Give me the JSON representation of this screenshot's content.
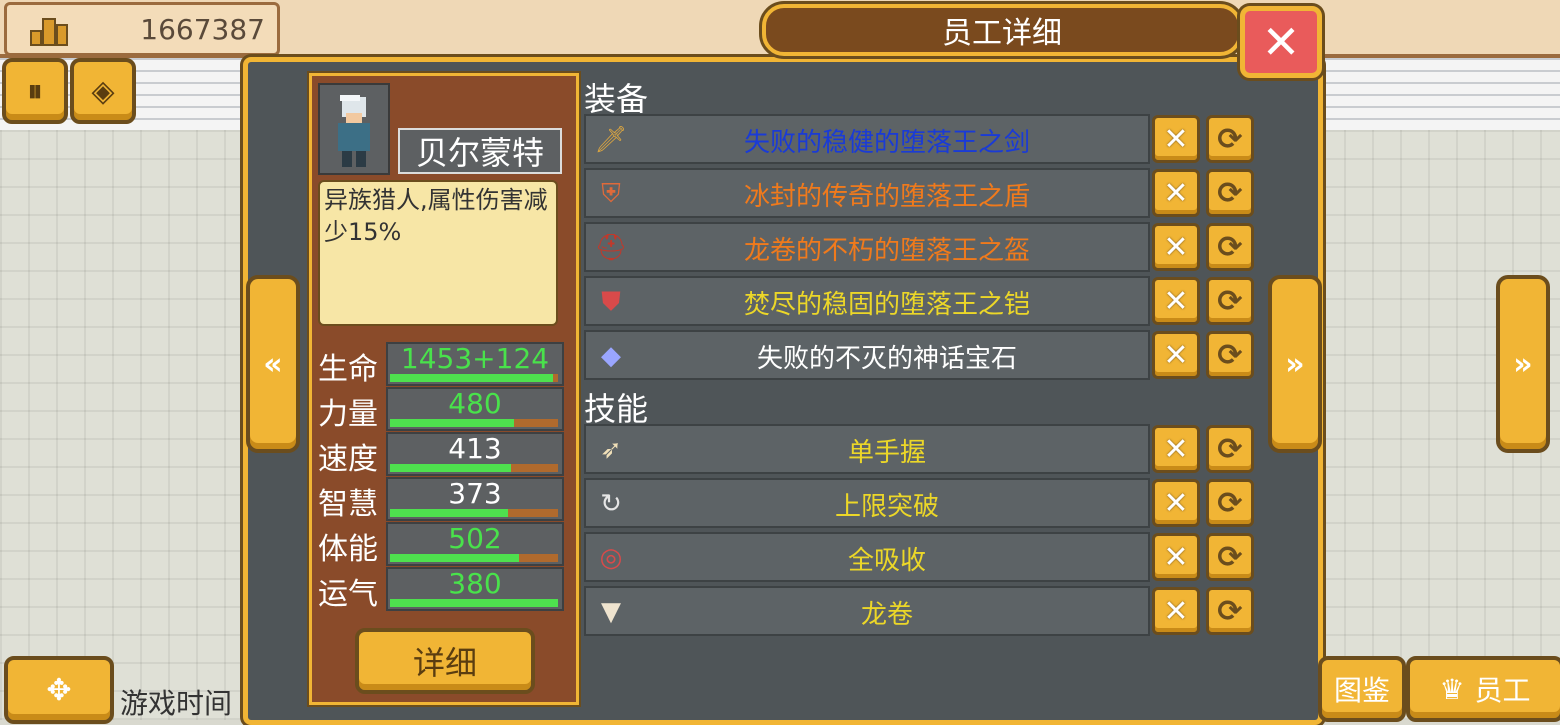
{
  "hud": {
    "money": "1667387",
    "game_time_label": "游戏时间"
  },
  "dialog": {
    "title": "员工详细",
    "close_glyph": "✕"
  },
  "employee": {
    "name": "贝尔蒙特",
    "description": "异族猎人,属性伤害减少15%",
    "detail_button": "详细",
    "stats": [
      {
        "label": "生命",
        "value": "1453+124",
        "color": "#49e24b",
        "fill": 0.97
      },
      {
        "label": "力量",
        "value": "480",
        "color": "#49e24b",
        "fill": 0.74
      },
      {
        "label": "速度",
        "value": "413",
        "color": "#ffffff",
        "fill": 0.72
      },
      {
        "label": "智慧",
        "value": "373",
        "color": "#ffffff",
        "fill": 0.7
      },
      {
        "label": "体能",
        "value": "502",
        "color": "#49e24b",
        "fill": 0.77
      },
      {
        "label": "运气",
        "value": "380",
        "color": "#49e24b",
        "fill": 1.0
      }
    ]
  },
  "equipment": {
    "header": "装备",
    "items": [
      {
        "name": "失败的稳健的堕落王之剑",
        "color": "#1a3bd6",
        "icon": "sword-icon"
      },
      {
        "name": "冰封的传奇的堕落王之盾",
        "color": "#f07a1c",
        "icon": "shield-icon"
      },
      {
        "name": "龙卷的不朽的堕落王之盔",
        "color": "#f07a1c",
        "icon": "helmet-icon"
      },
      {
        "name": "焚尽的稳固的堕落王之铠",
        "color": "#ecd728",
        "icon": "armor-icon"
      },
      {
        "name": "失败的不灭的神话宝石",
        "color": "#ffffff",
        "icon": "gem-icon"
      }
    ]
  },
  "skills": {
    "header": "技能",
    "items": [
      {
        "name": "单手握",
        "color": "#ecd728",
        "icon": "feather-sword-icon"
      },
      {
        "name": "上限突破",
        "color": "#ecd728",
        "icon": "cycle-icon"
      },
      {
        "name": "全吸收",
        "color": "#ecd728",
        "icon": "absorb-icon"
      },
      {
        "name": "龙卷",
        "color": "#ecd728",
        "icon": "tornado-icon"
      }
    ]
  },
  "bottom_nav": {
    "left_label": "图鉴",
    "right_label": "员工"
  },
  "icons": {
    "remove": "✕",
    "swap": "⟳",
    "prev": "«",
    "next": "»"
  }
}
